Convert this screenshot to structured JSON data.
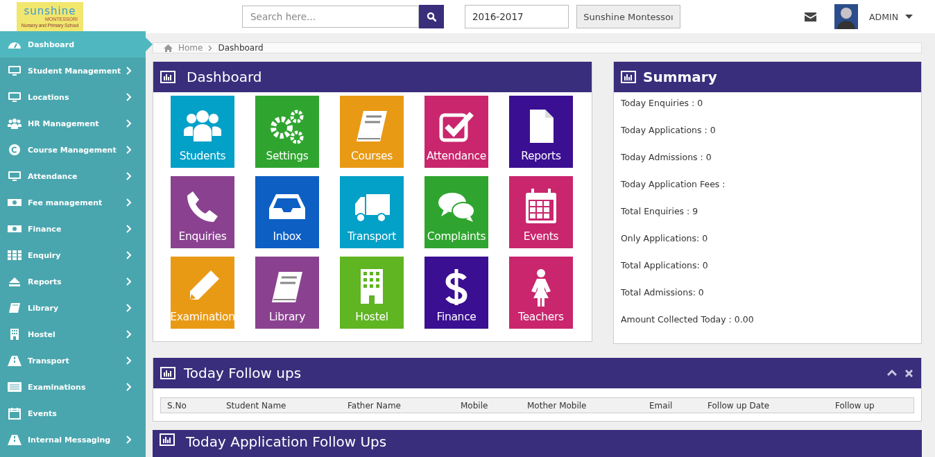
{
  "header": {
    "logo": {
      "name": "sunshine",
      "sub1": "MONTESSORI",
      "sub2": "Nursery and Primary School"
    },
    "search": {
      "placeholder": "Search here..."
    },
    "year": {
      "value": "2016-2017"
    },
    "school_button": "Sunshine Montessoı",
    "user": "ADMIN"
  },
  "sidebar": {
    "items": [
      {
        "label": "Dashboard",
        "selected": true,
        "has_submenu": false
      },
      {
        "label": "Student Management",
        "selected": false,
        "has_submenu": true
      },
      {
        "label": "Locations",
        "selected": false,
        "has_submenu": true
      },
      {
        "label": "HR Management",
        "selected": false,
        "has_submenu": true
      },
      {
        "label": "Course Management",
        "selected": false,
        "has_submenu": true
      },
      {
        "label": "Attendance",
        "selected": false,
        "has_submenu": true
      },
      {
        "label": "Fee management",
        "selected": false,
        "has_submenu": true
      },
      {
        "label": "Finance",
        "selected": false,
        "has_submenu": true
      },
      {
        "label": "Enquiry",
        "selected": false,
        "has_submenu": true
      },
      {
        "label": "Reports",
        "selected": false,
        "has_submenu": true
      },
      {
        "label": "Library",
        "selected": false,
        "has_submenu": true
      },
      {
        "label": "Hostel",
        "selected": false,
        "has_submenu": true
      },
      {
        "label": "Transport",
        "selected": false,
        "has_submenu": true
      },
      {
        "label": "Examinations",
        "selected": false,
        "has_submenu": true
      },
      {
        "label": "Events",
        "selected": false,
        "has_submenu": false
      },
      {
        "label": "Internal Messaging",
        "selected": false,
        "has_submenu": true
      }
    ]
  },
  "breadcrumb": [
    "Home",
    "Dashboard"
  ],
  "dashboard": {
    "title": "Dashboard",
    "tiles": [
      {
        "label": "Students",
        "color": "#03a0c8"
      },
      {
        "label": "Settings",
        "color": "#2fa52f"
      },
      {
        "label": "Courses",
        "color": "#e99a15"
      },
      {
        "label": "Attendance",
        "color": "#c9266d"
      },
      {
        "label": "Reports",
        "color": "#3a0f91"
      },
      {
        "label": "Enquiries",
        "color": "#8a4290"
      },
      {
        "label": "Inbox",
        "color": "#0d5fc4"
      },
      {
        "label": "Transport",
        "color": "#03a0c8"
      },
      {
        "label": "Complaints",
        "color": "#2fa52f"
      },
      {
        "label": "Events",
        "color": "#c9266d"
      },
      {
        "label": "Examination",
        "color": "#e99a15"
      },
      {
        "label": "Library",
        "color": "#8a4290"
      },
      {
        "label": "Hostel",
        "color": "#5fb522"
      },
      {
        "label": "Finance",
        "color": "#3a0f91"
      },
      {
        "label": "Teachers",
        "color": "#c9266d"
      }
    ]
  },
  "summary": {
    "title": "Summary",
    "lines": [
      "Today Enquiries : 0",
      "Today Applications : 0",
      "Today Admissions : 0",
      "Today Application Fees :",
      "Total Enquiries : 9",
      "Only Applications: 0",
      "Total Applications: 0",
      "Total Admissions: 0",
      "Amount Collected Today : 0.00"
    ]
  },
  "followups": {
    "title": "Today Follow ups",
    "columns": [
      "S.No",
      "Student Name",
      "Father Name",
      "Mobile",
      "Mother Mobile",
      "Email",
      "Follow up Date",
      "Follow up"
    ]
  },
  "application_followups": {
    "title": "Today Application Follow Ups"
  }
}
